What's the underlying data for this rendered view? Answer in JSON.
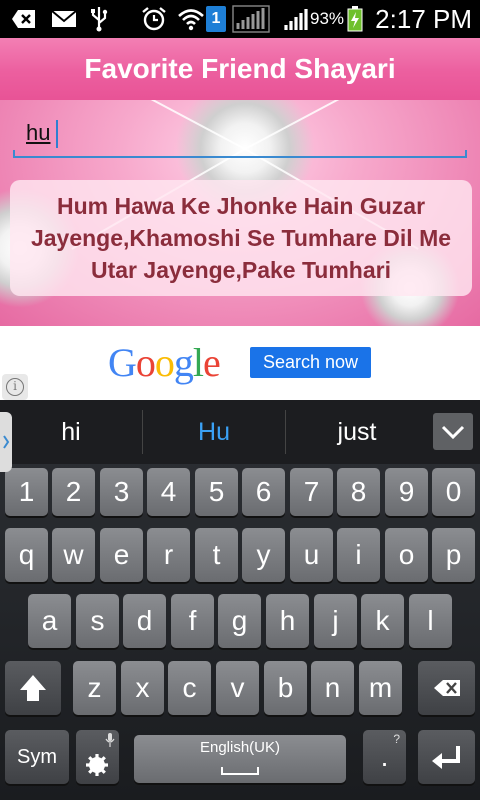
{
  "status": {
    "notification_count": "1",
    "battery": "93%",
    "time": "2:17 PM"
  },
  "app": {
    "title": "Favorite Friend Shayari",
    "search_value": "hu",
    "shayari_text": "Hum Hawa Ke Jhonke Hain Guzar Jayenge,Khamoshi Se Tumhare Dil Me Utar Jayenge,Pake Tumhari"
  },
  "ad": {
    "brand": "Google",
    "button_label": "Search now",
    "info_label": "i",
    "brand_colors": [
      "#4285f4",
      "#ea4335",
      "#fbbc05",
      "#4285f4",
      "#34a853",
      "#ea4335"
    ]
  },
  "keyboard": {
    "suggestions": [
      "hi",
      "Hu",
      "just"
    ],
    "suggestion_highlight_color": "#3aa1f5",
    "row_numbers": [
      "1",
      "2",
      "3",
      "4",
      "5",
      "6",
      "7",
      "8",
      "9",
      "0"
    ],
    "row1": [
      "q",
      "w",
      "e",
      "r",
      "t",
      "y",
      "u",
      "i",
      "o",
      "p"
    ],
    "row2": [
      "a",
      "s",
      "d",
      "f",
      "g",
      "h",
      "j",
      "k",
      "l"
    ],
    "row3": [
      "z",
      "x",
      "c",
      "v",
      "b",
      "n",
      "m"
    ],
    "sym_label": "Sym",
    "space_label": "English(UK)",
    "period_label": ".",
    "period_sub": "?",
    "icons": [
      "shift-icon",
      "backspace-icon",
      "settings-gear-icon",
      "microphone-icon",
      "enter-icon",
      "chevron-down-icon"
    ]
  }
}
